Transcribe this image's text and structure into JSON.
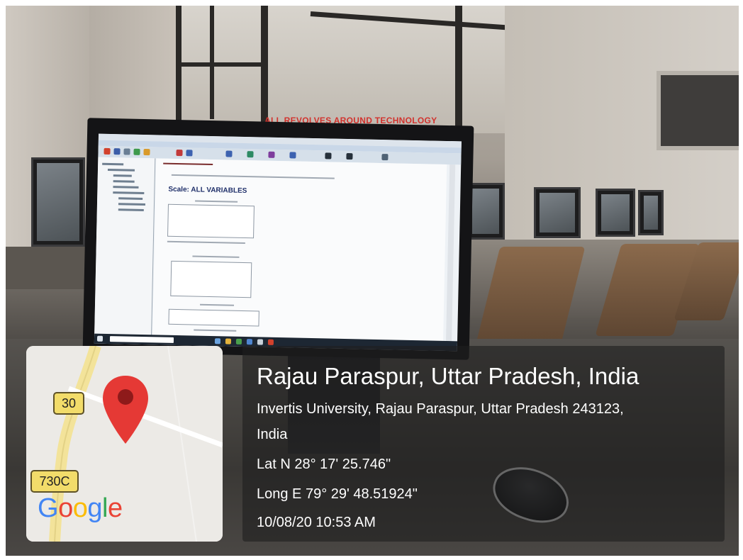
{
  "scene": {
    "sign_text": "ALL REVOLVES AROUND TECHNOLOGY",
    "monitor_heading": "Scale: ALL VARIABLES"
  },
  "map": {
    "road_shield_1": "30",
    "road_shield_2": "730C",
    "brand": [
      "G",
      "o",
      "o",
      "g",
      "l",
      "e"
    ],
    "brand_colors": [
      "#4285f4",
      "#ea4335",
      "#fbbc05",
      "#4285f4",
      "#34a853",
      "#ea4335"
    ],
    "pin_color": "#e53935",
    "icon": "map-pin-icon"
  },
  "location": {
    "title": "Rajau Paraspur, Uttar Pradesh, India",
    "address_line1": "Invertis University, Rajau Paraspur, Uttar Pradesh 243123,",
    "address_line2": "India",
    "latitude": "Lat N 28° 17' 25.746\"",
    "longitude": "Long E 79° 29' 48.51924\"",
    "timestamp": "10/08/20 10:53 AM"
  }
}
